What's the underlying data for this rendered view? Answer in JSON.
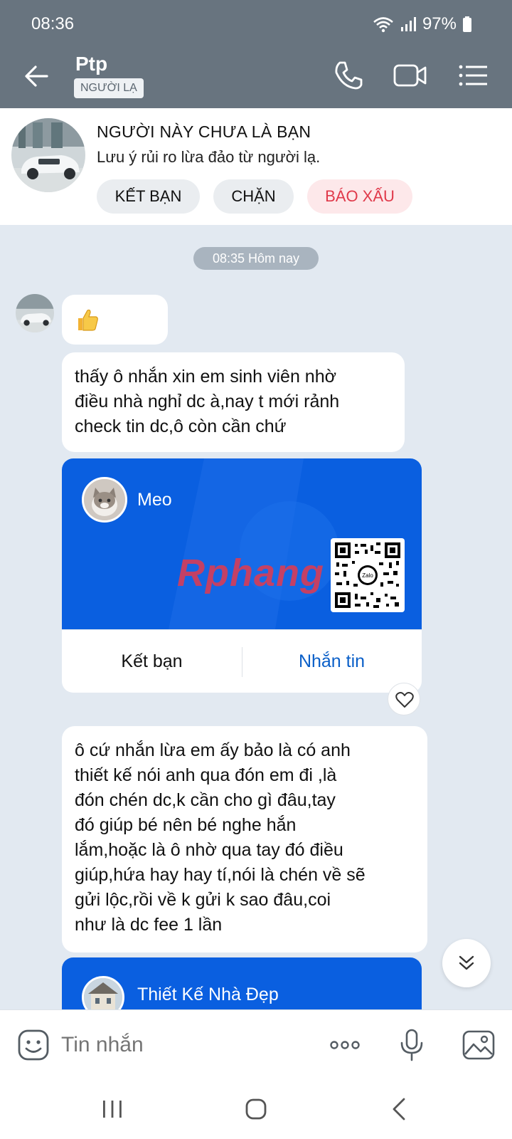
{
  "status": {
    "time": "08:36",
    "battery": "97%"
  },
  "header": {
    "name": "Ptp",
    "badge": "NGƯỜI LẠ"
  },
  "stranger": {
    "title": "NGƯỜI NÀY CHƯA LÀ BẠN",
    "note": "Lưu ý rủi ro lừa đảo từ người lạ.",
    "add_friend": "KẾT BẠN",
    "block": "CHẶN",
    "report": "BÁO XẤU"
  },
  "chat": {
    "time_chip": "08:35 Hôm nay",
    "msg1": "thấy ô nhắn xin em sinh viên nhờ\nđiều nhà nghỉ dc à,nay t mới rảnh\ncheck tin dc,ô còn cần chứ",
    "card": {
      "name": "Meo",
      "watermark": "Rphang",
      "add_friend": "Kết bạn",
      "message": "Nhắn tin"
    },
    "msg2": "ô cứ nhắn lừa em ấy bảo là có anh\nthiết kế nói anh qua đón em đi ,là\nđón chén dc,k cần cho gì đâu,tay\nđó giúp bé nên bé nghe hắn\nlắm,hoặc là ô nhờ qua tay đó điều\ngiúp,hứa hay hay tí,nói là chén về sẽ\ngửi lộc,rồi về k gửi k sao đâu,coi\nnhư là dc fee 1 lần",
    "card2": {
      "name": "Thiết Kế Nhà Đẹp"
    }
  },
  "composer": {
    "placeholder": "Tin nhắn"
  },
  "colors": {
    "header": "#68747f",
    "card_blue": "#0a5fe0",
    "link_blue": "#0a5fc8",
    "report_red": "#e0394a"
  }
}
